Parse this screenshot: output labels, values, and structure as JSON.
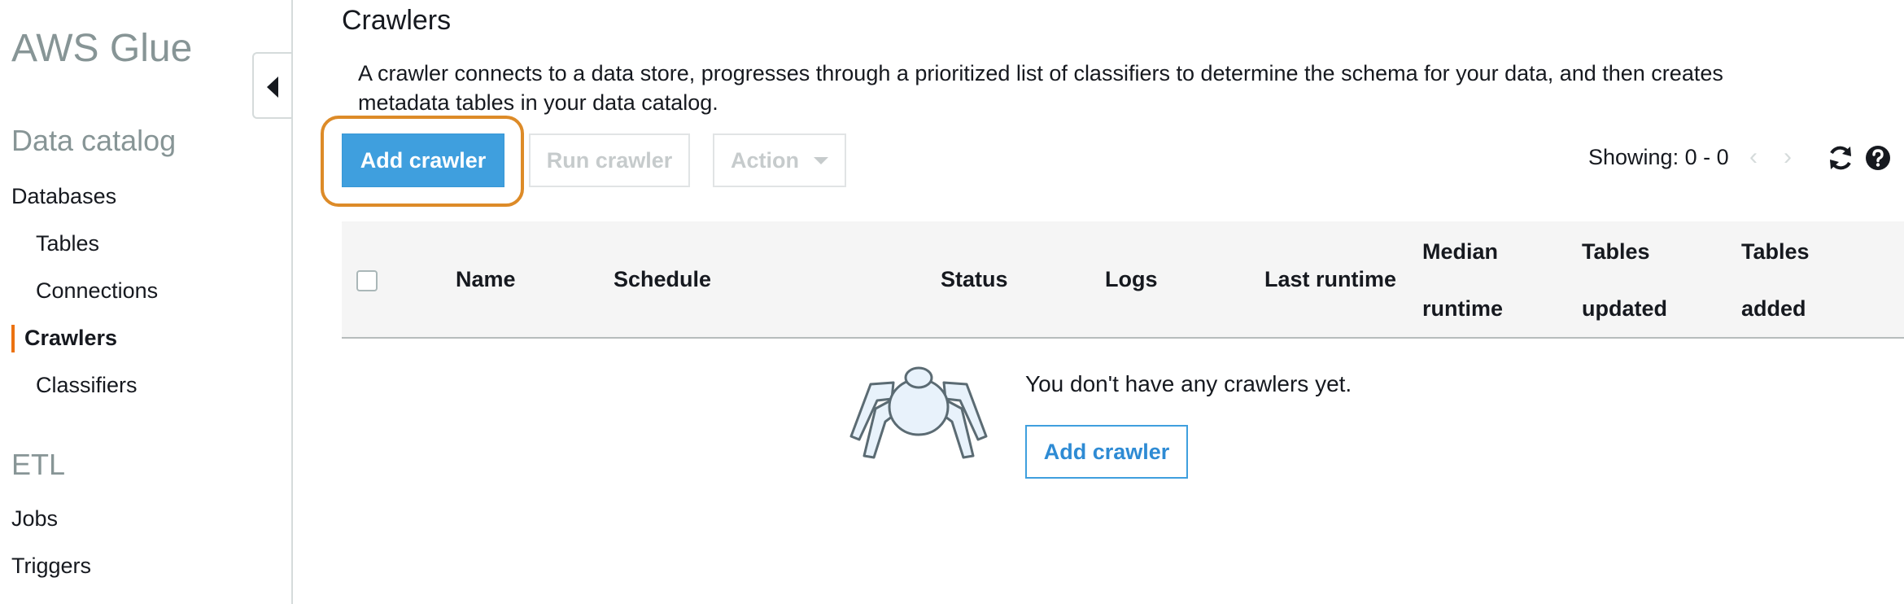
{
  "sidebar": {
    "brand": "AWS Glue",
    "data_catalog_title": "Data catalog",
    "databases": "Databases",
    "tables": "Tables",
    "connections": "Connections",
    "crawlers": "Crawlers",
    "classifiers": "Classifiers",
    "etl_title": "ETL",
    "jobs": "Jobs",
    "triggers": "Triggers",
    "active_accent": "#ec7211"
  },
  "main": {
    "title": "Crawlers",
    "description": "A crawler connects to a data store, progresses through a prioritized list of classifiers to determine the schema for your data, and then creates metadata tables in your data catalog.",
    "toolbar": {
      "add_crawler": "Add crawler",
      "run_crawler": "Run crawler",
      "action": "Action",
      "showing_label": "Showing: 0 - 0",
      "prev_icon": "chevron-left-icon",
      "next_icon": "chevron-right-icon",
      "refresh_icon": "refresh-icon",
      "help_icon": "help-icon"
    },
    "table": {
      "columns": {
        "name": "Name",
        "schedule": "Schedule",
        "status": "Status",
        "logs": "Logs",
        "last_runtime": "Last runtime",
        "median_runtime_1": "Median",
        "median_runtime_2": "runtime",
        "tables_updated_1": "Tables",
        "tables_updated_2": "updated",
        "tables_added_1": "Tables",
        "tables_added_2": "added"
      }
    },
    "empty_state": {
      "message": "You don't have any crawlers yet.",
      "button": "Add crawler",
      "icon": "spider-icon"
    }
  },
  "colors": {
    "primary": "#3f9fde",
    "highlight": "#dd8b28"
  }
}
